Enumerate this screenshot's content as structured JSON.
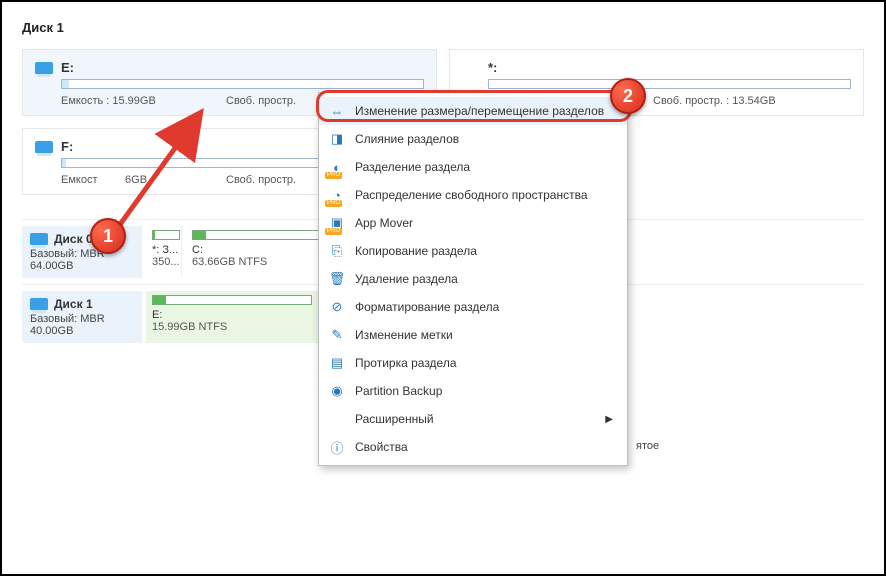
{
  "title": "Диск 1",
  "cards": [
    {
      "label": "E:",
      "capacity": "Емкость : 15.99GB",
      "free": "Своб. простр.",
      "fill": 2
    },
    {
      "label": "*:",
      "capacity": "",
      "free": "Своб. простр. : 13.54GB",
      "fill": 0
    }
  ],
  "card2": {
    "label": "F:",
    "capacity": "Емкост",
    "capacity_suffix": "6GB",
    "free": "Своб. простр."
  },
  "disks": [
    {
      "name": "Диск 0",
      "type": "Базовый: MBR",
      "size": "64.00GB",
      "parts": [
        {
          "label": "*: З...",
          "sub": "350...",
          "width": 36,
          "miniw": 28
        },
        {
          "label": "C:",
          "sub": "63.66GB NTFS",
          "width": 190,
          "miniw": 160
        }
      ]
    },
    {
      "name": "Диск 1",
      "type": "Базовый: MBR",
      "size": "40.00GB",
      "parts": [
        {
          "label": "E:",
          "sub": "15.99GB NTFS",
          "width": 190,
          "miniw": 160,
          "selected": true
        }
      ],
      "stray": "ятое"
    }
  ],
  "menu": [
    {
      "icon": "⇔",
      "label": "Изменение размера/перемещение разделов",
      "hi": true
    },
    {
      "icon": "◨",
      "label": "Слияние разделов"
    },
    {
      "icon": "◐",
      "label": "Разделение раздела",
      "pro": true
    },
    {
      "icon": "◔",
      "label": "Распределение свободного пространства",
      "pro": true
    },
    {
      "icon": "▣",
      "label": "App Mover",
      "pro": true
    },
    {
      "icon": "⎘",
      "label": "Копирование раздела"
    },
    {
      "icon": "🗑",
      "label": "Удаление раздела"
    },
    {
      "icon": "⊘",
      "label": "Форматирование раздела"
    },
    {
      "icon": "✎",
      "label": "Изменение метки"
    },
    {
      "icon": "▤",
      "label": "Протирка раздела"
    },
    {
      "icon": "◉",
      "label": "Partition Backup"
    },
    {
      "icon": "",
      "label": "Расширенный",
      "arrow": true
    },
    {
      "icon": "ⓘ",
      "label": "Свойства"
    }
  ],
  "bubbles": {
    "one": "1",
    "two": "2"
  }
}
